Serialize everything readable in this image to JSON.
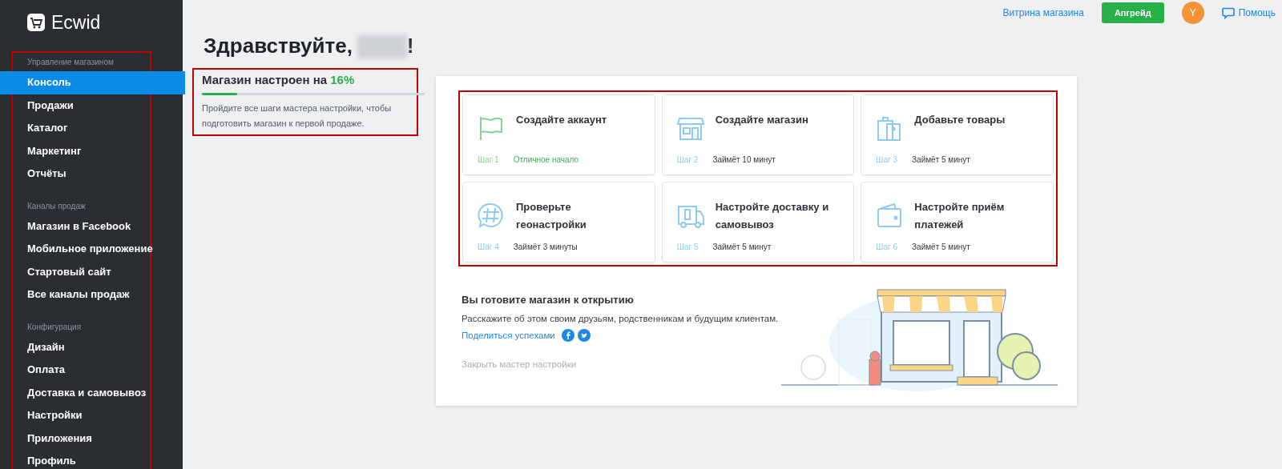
{
  "sidebar": {
    "logo": "Ecwid",
    "highlighted": true,
    "sections": [
      {
        "title": "Управление магазином",
        "items": [
          {
            "label": "Консоль",
            "selected": true
          },
          {
            "label": "Продажи",
            "selected": false
          },
          {
            "label": "Каталог",
            "selected": false
          },
          {
            "label": "Маркетинг",
            "selected": false
          },
          {
            "label": "Отчёты",
            "selected": false
          }
        ]
      },
      {
        "title": "Каналы продаж",
        "items": [
          {
            "label": "Магазин в Facebook",
            "selected": false
          },
          {
            "label": "Мобильное приложение",
            "selected": false
          },
          {
            "label": "Стартовый сайт",
            "selected": false
          },
          {
            "label": "Все каналы продаж",
            "selected": false
          }
        ]
      },
      {
        "title": "Конфигурация",
        "items": [
          {
            "label": "Дизайн",
            "selected": false
          },
          {
            "label": "Оплата",
            "selected": false
          },
          {
            "label": "Доставка и самовывоз",
            "selected": false
          },
          {
            "label": "Настройки",
            "selected": false
          },
          {
            "label": "Приложения",
            "selected": false
          },
          {
            "label": "Профиль",
            "selected": false
          }
        ]
      }
    ]
  },
  "topbar": {
    "storefront_link": "Витрина магазина",
    "upgrade_button": "Апгрейд",
    "avatar_letter": "Y",
    "help_link": "Помощь"
  },
  "greeting": {
    "prefix": "Здравствуйте,",
    "suffix": "!"
  },
  "progress": {
    "highlighted": true,
    "title": "Магазин настроен на",
    "percent": "16%",
    "level": 0.16,
    "description": "Пройдите все шаги мастера настройки, чтобы подготовить магазин к первой продаже."
  },
  "steps": {
    "highlighted": true,
    "items": [
      {
        "kind": "flag",
        "title": "Создайте аккаунт",
        "step": "Шаг 1",
        "note": "Отличное начало",
        "done": true
      },
      {
        "kind": "store",
        "title": "Создайте магазин",
        "step": "Шаг 2",
        "note": "Займёт 10 минут",
        "done": false
      },
      {
        "kind": "bags",
        "title": "Добавьте товары",
        "step": "Шаг 3",
        "note": "Займёт 5 минут",
        "done": false
      },
      {
        "kind": "globe",
        "title": "Проверьте геонастройки",
        "step": "Шаг 4",
        "note": "Займёт 3 минуты",
        "done": false
      },
      {
        "kind": "truck",
        "title": "Настройте доставку и самовывоз",
        "step": "Шаг 5",
        "note": "Займёт 5 минут",
        "done": false
      },
      {
        "kind": "wallet",
        "title": "Настройте приём платежей",
        "step": "Шаг 6",
        "note": "Займёт 5 минут",
        "done": false
      }
    ]
  },
  "opening": {
    "title": "Вы готовите магазин к открытию",
    "text": "Расскажите об этом своим друзьям, родственникам и будущим клиентам.",
    "share_link": "Поделиться успехами",
    "close_link": "Закрыть мастер настройки"
  }
}
